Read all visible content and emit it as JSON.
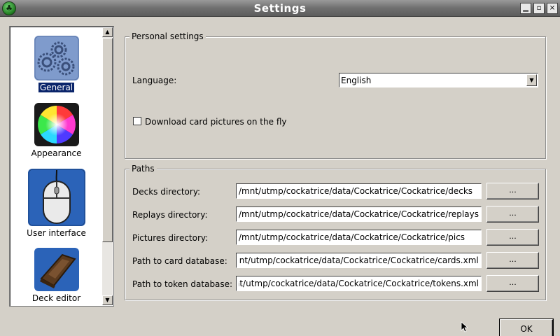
{
  "window": {
    "title": "Settings",
    "app_icon": "cockatrice-icon",
    "buttons": [
      "minimize",
      "maximize",
      "close"
    ]
  },
  "sidebar": {
    "items": [
      {
        "label": "General",
        "icon": "gears-icon",
        "selected": true
      },
      {
        "label": "Appearance",
        "icon": "color-wheel-icon",
        "selected": false
      },
      {
        "label": "User interface",
        "icon": "mouse-icon",
        "selected": false
      },
      {
        "label": "Deck editor",
        "icon": "deck-icon",
        "selected": false
      }
    ]
  },
  "personal": {
    "title": "Personal settings",
    "language_label": "Language:",
    "language_value": "English",
    "download_label": "Download card pictures on the fly",
    "download_checked": false
  },
  "paths": {
    "title": "Paths",
    "rows": [
      {
        "label": "Decks directory:",
        "value": "/mnt/utmp/cockatrice/data/Cockatrice/Cockatrice/decks",
        "button": "..."
      },
      {
        "label": "Replays directory:",
        "value": "/mnt/utmp/cockatrice/data/Cockatrice/Cockatrice/replays",
        "button": "..."
      },
      {
        "label": "Pictures directory:",
        "value": "/mnt/utmp/cockatrice/data/Cockatrice/Cockatrice/pics",
        "button": "..."
      },
      {
        "label": "Path to card database:",
        "value": "/mnt/utmp/cockatrice/data/Cockatrice/Cockatrice/cards.xml",
        "button": "..."
      },
      {
        "label": "Path to token database:",
        "value": "/mnt/utmp/cockatrice/data/Cockatrice/Cockatrice/tokens.xml",
        "button": "..."
      }
    ]
  },
  "footer": {
    "ok_label": "OK"
  }
}
